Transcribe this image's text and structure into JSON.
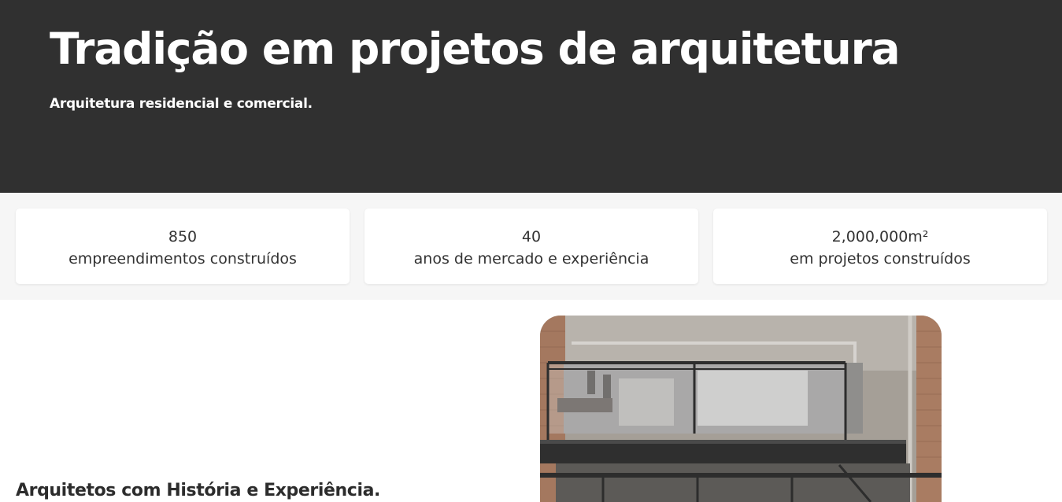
{
  "hero": {
    "title": "Tradição em projetos de arquitetura",
    "subtitle": "Arquitetura residencial e comercial."
  },
  "stats": [
    {
      "value": "850",
      "label": "empreendimentos construídos"
    },
    {
      "value": "40",
      "label": "anos de mercado e experiência"
    },
    {
      "value": "2,000,000m²",
      "label": "em projetos construídos"
    }
  ],
  "about": {
    "title": "Arquitetos com História e Experiência."
  },
  "colors": {
    "hero_background": "#303030",
    "stats_background": "#f6f6f6",
    "card_background": "#ffffff",
    "text": "#333333"
  }
}
